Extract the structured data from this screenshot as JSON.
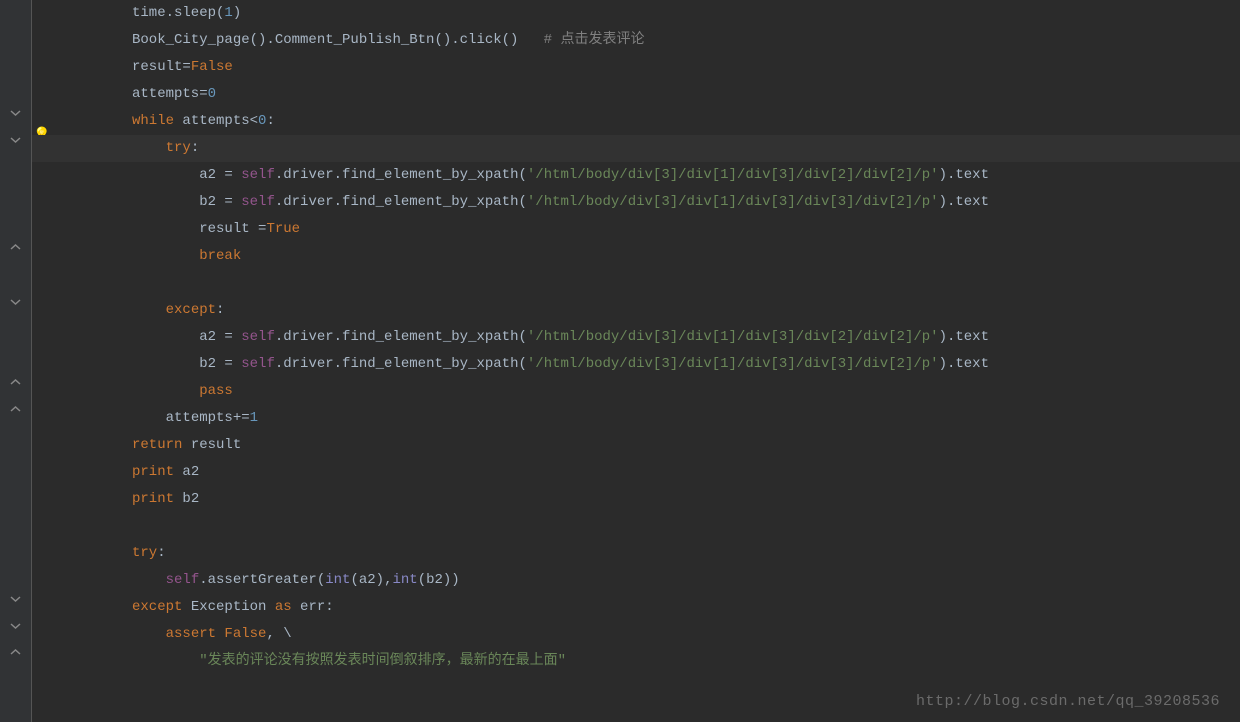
{
  "code": {
    "line1": {
      "p1": "time.sleep(",
      "p2": "1",
      "p3": ")"
    },
    "line2": {
      "p1": "Book_City_page().Comment_Publish_Btn().click()   ",
      "p2": "# 点击发表评论"
    },
    "line3": {
      "p1": "result=",
      "p2": "False"
    },
    "line4": {
      "p1": "attempts=",
      "p2": "0"
    },
    "line5": {
      "p1": "while ",
      "p2": "attempts<",
      "p3": "0",
      "p4": ":"
    },
    "line6": {
      "p1": "try",
      "p2": ":"
    },
    "line7": {
      "p1": "a2 = ",
      "p2": "self",
      "p3": ".driver.find_element_by_xpath(",
      "p4": "'/html/body/div[3]/div[1]/div[3]/div[2]/div[2]/p'",
      "p5": ").text"
    },
    "line8": {
      "p1": "b2 = ",
      "p2": "self",
      "p3": ".driver.find_element_by_xpath(",
      "p4": "'/html/body/div[3]/div[1]/div[3]/div[3]/div[2]/p'",
      "p5": ").text"
    },
    "line9": {
      "p1": "result =",
      "p2": "True"
    },
    "line10": {
      "p1": "break"
    },
    "line12": {
      "p1": "except",
      "p2": ":"
    },
    "line13": {
      "p1": "a2 = ",
      "p2": "self",
      "p3": ".driver.find_element_by_xpath(",
      "p4": "'/html/body/div[3]/div[1]/div[3]/div[2]/div[2]/p'",
      "p5": ").text"
    },
    "line14": {
      "p1": "b2 = ",
      "p2": "self",
      "p3": ".driver.find_element_by_xpath(",
      "p4": "'/html/body/div[3]/div[1]/div[3]/div[3]/div[2]/p'",
      "p5": ").text"
    },
    "line15": {
      "p1": "pass"
    },
    "line16": {
      "p1": "attempts+=",
      "p2": "1"
    },
    "line17": {
      "p1": "return ",
      "p2": "result"
    },
    "line18": {
      "p1": "print ",
      "p2": "a2"
    },
    "line19": {
      "p1": "print ",
      "p2": "b2"
    },
    "line21": {
      "p1": "try",
      "p2": ":"
    },
    "line22": {
      "p1": "self",
      "p2": ".assertGreater(",
      "p3": "int",
      "p4": "(a2),",
      "p5": "int",
      "p6": "(b2))"
    },
    "line23": {
      "p1": "except ",
      "p2": "Exception ",
      "p3": "as ",
      "p4": "err:"
    },
    "line24": {
      "p1": "assert ",
      "p2": "False",
      "p3": ", \\"
    },
    "line25": {
      "p1": "\"发表的评论没有按照发表时间倒叙排序，最新的在最上面\""
    }
  },
  "watermark": "http://blog.csdn.net/qq_39208536",
  "indent": {
    "i0": "",
    "i1": "    ",
    "i2": "        ",
    "i3": "            "
  }
}
